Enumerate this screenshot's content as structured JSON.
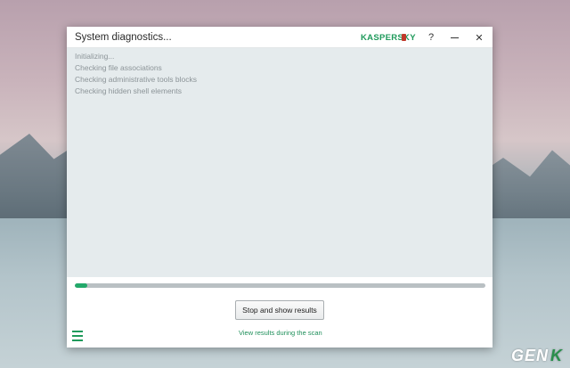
{
  "window": {
    "title": "System diagnostics...",
    "brand": "KASPERSKY",
    "help_label": "?",
    "close_label": "✕"
  },
  "log": {
    "lines": [
      "Initializing...",
      "Checking file associations",
      "Checking administrative tools blocks",
      "Checking hidden shell elements"
    ]
  },
  "progress": {
    "fraction": 0.03
  },
  "actions": {
    "stop_label": "Stop and show results",
    "view_link": "View results during the scan"
  },
  "watermark": {
    "text_part1": "GEN",
    "text_part2": "K"
  },
  "colors": {
    "accent": "#23a96a",
    "log_background": "#e5ebed"
  }
}
